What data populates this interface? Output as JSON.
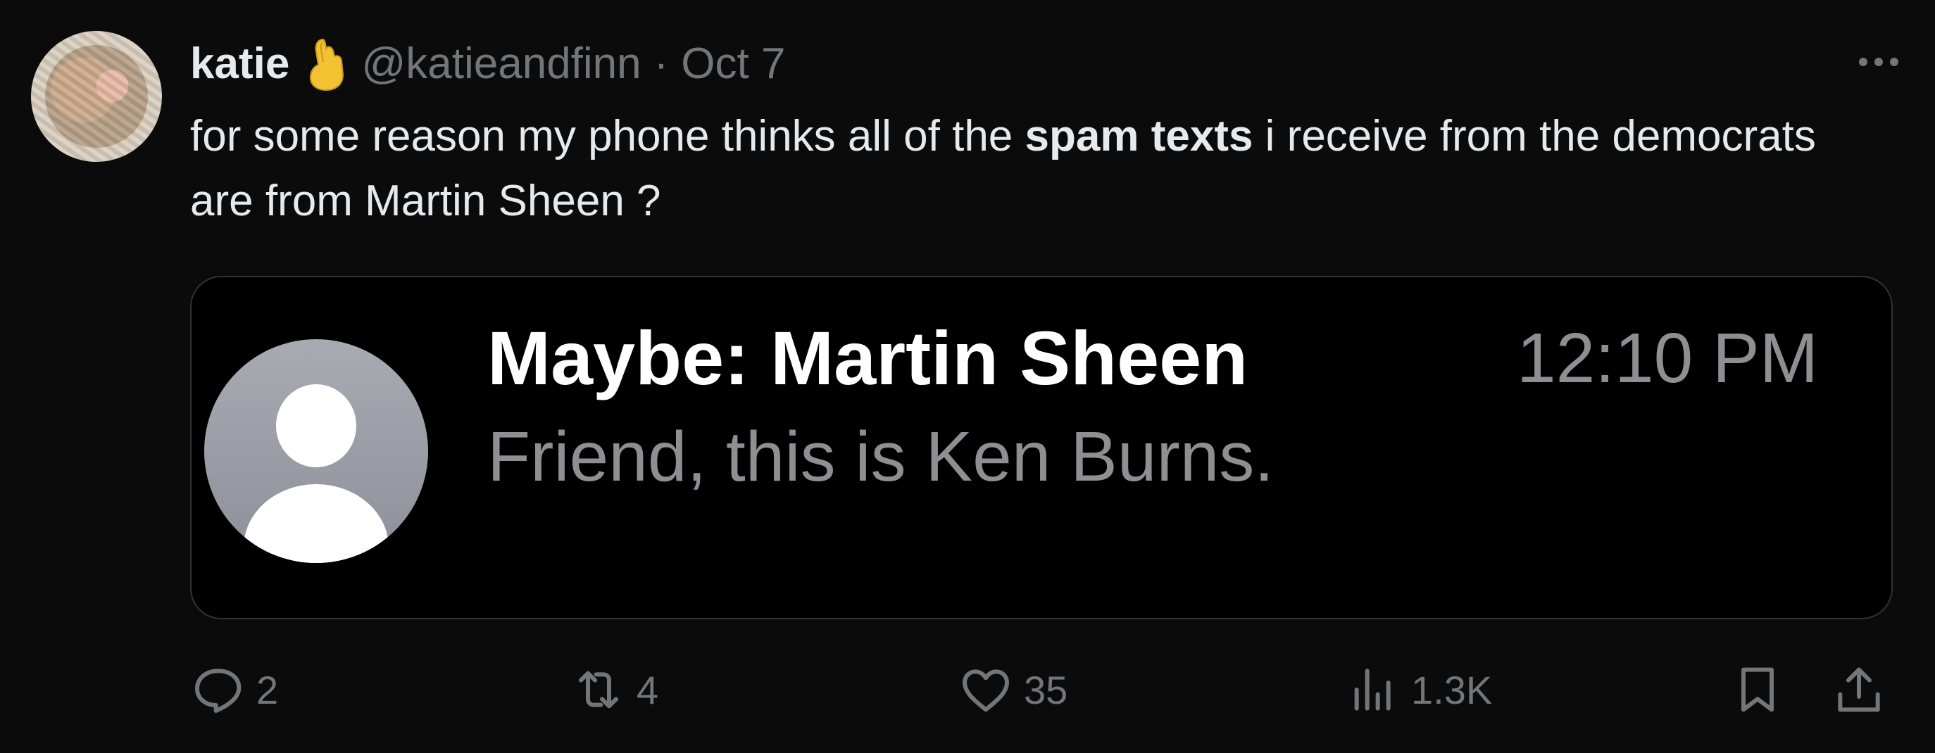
{
  "post": {
    "author_name": "katie",
    "author_emoji": "pinched-fingers-emoji",
    "handle": "@katieandfinn",
    "separator": "·",
    "date": "Oct 7",
    "text_before": "for some reason my phone thinks all of the ",
    "text_bold": "spam texts",
    "text_after": " i receive from the democrats are from Martin Sheen ?"
  },
  "media": {
    "sender": "Maybe: Martin Sheen",
    "time": "12:10 PM",
    "preview": "Friend, this is Ken Burns."
  },
  "actions": {
    "replies": "2",
    "reposts": "4",
    "likes": "35",
    "views": "1.3K"
  },
  "icons": {
    "reply": "reply-icon",
    "repost": "repost-icon",
    "like": "heart-icon",
    "views": "views-icon",
    "bookmark": "bookmark-icon",
    "share": "share-icon",
    "more": "more-icon"
  },
  "colors": {
    "background": "#0b0b0c",
    "text": "#e7e9ea",
    "muted": "#71767b",
    "media_border": "#2f3336"
  }
}
